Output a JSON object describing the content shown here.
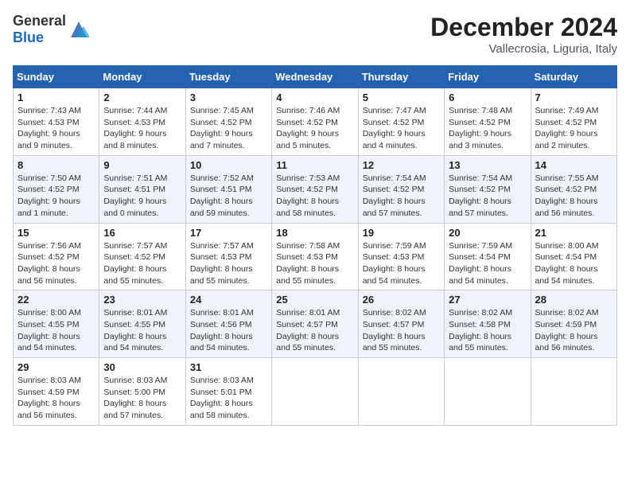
{
  "header": {
    "logo_general": "General",
    "logo_blue": "Blue",
    "month": "December 2024",
    "location": "Vallecrosia, Liguria, Italy"
  },
  "weekdays": [
    "Sunday",
    "Monday",
    "Tuesday",
    "Wednesday",
    "Thursday",
    "Friday",
    "Saturday"
  ],
  "weeks": [
    [
      {
        "day": "1",
        "sunrise": "7:43 AM",
        "sunset": "4:53 PM",
        "daylight": "9 hours and 9 minutes."
      },
      {
        "day": "2",
        "sunrise": "7:44 AM",
        "sunset": "4:53 PM",
        "daylight": "9 hours and 8 minutes."
      },
      {
        "day": "3",
        "sunrise": "7:45 AM",
        "sunset": "4:52 PM",
        "daylight": "9 hours and 7 minutes."
      },
      {
        "day": "4",
        "sunrise": "7:46 AM",
        "sunset": "4:52 PM",
        "daylight": "9 hours and 5 minutes."
      },
      {
        "day": "5",
        "sunrise": "7:47 AM",
        "sunset": "4:52 PM",
        "daylight": "9 hours and 4 minutes."
      },
      {
        "day": "6",
        "sunrise": "7:48 AM",
        "sunset": "4:52 PM",
        "daylight": "9 hours and 3 minutes."
      },
      {
        "day": "7",
        "sunrise": "7:49 AM",
        "sunset": "4:52 PM",
        "daylight": "9 hours and 2 minutes."
      }
    ],
    [
      {
        "day": "8",
        "sunrise": "7:50 AM",
        "sunset": "4:52 PM",
        "daylight": "9 hours and 1 minute."
      },
      {
        "day": "9",
        "sunrise": "7:51 AM",
        "sunset": "4:51 PM",
        "daylight": "9 hours and 0 minutes."
      },
      {
        "day": "10",
        "sunrise": "7:52 AM",
        "sunset": "4:51 PM",
        "daylight": "8 hours and 59 minutes."
      },
      {
        "day": "11",
        "sunrise": "7:53 AM",
        "sunset": "4:52 PM",
        "daylight": "8 hours and 58 minutes."
      },
      {
        "day": "12",
        "sunrise": "7:54 AM",
        "sunset": "4:52 PM",
        "daylight": "8 hours and 57 minutes."
      },
      {
        "day": "13",
        "sunrise": "7:54 AM",
        "sunset": "4:52 PM",
        "daylight": "8 hours and 57 minutes."
      },
      {
        "day": "14",
        "sunrise": "7:55 AM",
        "sunset": "4:52 PM",
        "daylight": "8 hours and 56 minutes."
      }
    ],
    [
      {
        "day": "15",
        "sunrise": "7:56 AM",
        "sunset": "4:52 PM",
        "daylight": "8 hours and 56 minutes."
      },
      {
        "day": "16",
        "sunrise": "7:57 AM",
        "sunset": "4:52 PM",
        "daylight": "8 hours and 55 minutes."
      },
      {
        "day": "17",
        "sunrise": "7:57 AM",
        "sunset": "4:53 PM",
        "daylight": "8 hours and 55 minutes."
      },
      {
        "day": "18",
        "sunrise": "7:58 AM",
        "sunset": "4:53 PM",
        "daylight": "8 hours and 55 minutes."
      },
      {
        "day": "19",
        "sunrise": "7:59 AM",
        "sunset": "4:53 PM",
        "daylight": "8 hours and 54 minutes."
      },
      {
        "day": "20",
        "sunrise": "7:59 AM",
        "sunset": "4:54 PM",
        "daylight": "8 hours and 54 minutes."
      },
      {
        "day": "21",
        "sunrise": "8:00 AM",
        "sunset": "4:54 PM",
        "daylight": "8 hours and 54 minutes."
      }
    ],
    [
      {
        "day": "22",
        "sunrise": "8:00 AM",
        "sunset": "4:55 PM",
        "daylight": "8 hours and 54 minutes."
      },
      {
        "day": "23",
        "sunrise": "8:01 AM",
        "sunset": "4:55 PM",
        "daylight": "8 hours and 54 minutes."
      },
      {
        "day": "24",
        "sunrise": "8:01 AM",
        "sunset": "4:56 PM",
        "daylight": "8 hours and 54 minutes."
      },
      {
        "day": "25",
        "sunrise": "8:01 AM",
        "sunset": "4:57 PM",
        "daylight": "8 hours and 55 minutes."
      },
      {
        "day": "26",
        "sunrise": "8:02 AM",
        "sunset": "4:57 PM",
        "daylight": "8 hours and 55 minutes."
      },
      {
        "day": "27",
        "sunrise": "8:02 AM",
        "sunset": "4:58 PM",
        "daylight": "8 hours and 55 minutes."
      },
      {
        "day": "28",
        "sunrise": "8:02 AM",
        "sunset": "4:59 PM",
        "daylight": "8 hours and 56 minutes."
      }
    ],
    [
      {
        "day": "29",
        "sunrise": "8:03 AM",
        "sunset": "4:59 PM",
        "daylight": "8 hours and 56 minutes."
      },
      {
        "day": "30",
        "sunrise": "8:03 AM",
        "sunset": "5:00 PM",
        "daylight": "8 hours and 57 minutes."
      },
      {
        "day": "31",
        "sunrise": "8:03 AM",
        "sunset": "5:01 PM",
        "daylight": "8 hours and 58 minutes."
      },
      null,
      null,
      null,
      null
    ]
  ]
}
